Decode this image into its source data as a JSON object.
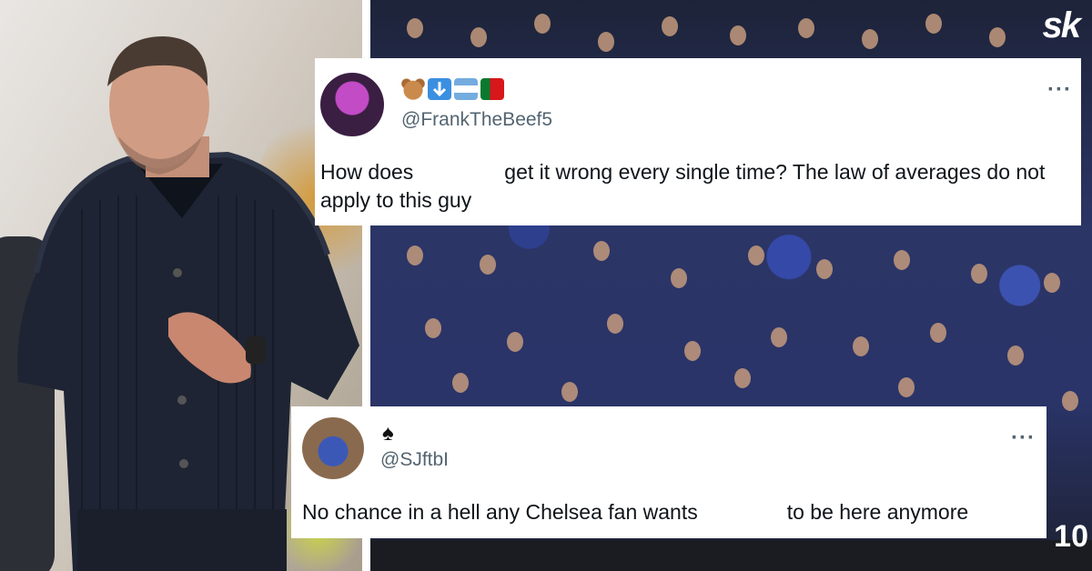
{
  "brand": {
    "logo": "sk"
  },
  "photo_overlay": {
    "number": "10"
  },
  "tweets": [
    {
      "emoji_icons": [
        "bear-face-icon",
        "down-arrow-icon",
        "argentina-flag-icon",
        "portugal-flag-icon"
      ],
      "handle": "@FrankTheBeef5",
      "text_before": "How does",
      "text_after": "get it wrong every single time? The law of averages do not apply to this guy",
      "more_label": "···"
    },
    {
      "emoji_icons": [
        "spade-suit-icon"
      ],
      "spade_glyph": "♠",
      "handle": "@SJftbI",
      "text_before": "No chance in a hell any Chelsea fan wants",
      "text_after": "to be here anymore",
      "more_label": "···"
    }
  ],
  "colors": {
    "text": "#0f1419",
    "handle": "#536471",
    "crowd_blue": "#2e3f8e"
  }
}
